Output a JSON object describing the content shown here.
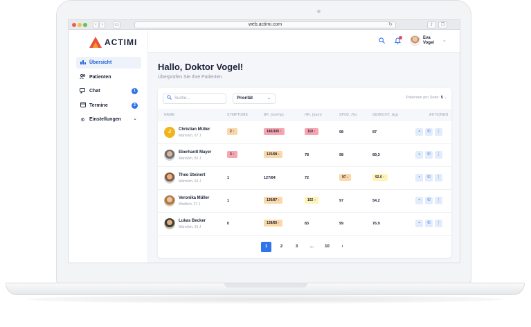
{
  "browser": {
    "url": "web.actimi.com",
    "back": "‹",
    "forward": "›",
    "reload": "↻"
  },
  "brand": {
    "logo_text": "ACTIMI",
    "accent": "#e8503a",
    "logo_orange": "#f29b2b"
  },
  "sidebar": {
    "items": [
      {
        "label": "Übersicht",
        "icon": "chart-bar-icon",
        "glyph": "▮",
        "active": true
      },
      {
        "label": "Patienten",
        "icon": "users-icon",
        "glyph": "👥"
      },
      {
        "label": "Chat",
        "icon": "chat-icon",
        "glyph": "💬",
        "badge": "1"
      },
      {
        "label": "Termine",
        "icon": "calendar-icon",
        "glyph": "▦",
        "badge": "2"
      },
      {
        "label": "Einstellungen",
        "icon": "gear-icon",
        "glyph": "⚙",
        "chevron": "⌄"
      }
    ]
  },
  "topbar": {
    "user_first": "Eva",
    "user_last": "Vogel"
  },
  "main": {
    "greeting": "Hallo, Doktor Vogel!",
    "subtitle": "Überprüfen Sie Ihre Patienten"
  },
  "filters": {
    "search_placeholder": "Suche...",
    "priority_label": "Priorität",
    "per_page_label": "Patienten pro Seite:",
    "per_page_value": "5"
  },
  "table": {
    "headers": [
      "NAME",
      "SYMPTOME",
      "BP, (mmHg)",
      "HR, (bpm)",
      "SPO2, (%)",
      "GEWICHT, (kg)",
      "AKTIONEN"
    ],
    "rows": [
      {
        "name": "Christian Müller",
        "meta": "Männlich, 67 J",
        "initial": "J",
        "symptoms": "2 ↑",
        "symptoms_level": "orange",
        "bp": "140/100 ↑",
        "bp_level": "red",
        "hr": "110 ↑",
        "hr_level": "red",
        "spo2": "98",
        "spo2_level": "",
        "weight": "87",
        "weight_level": ""
      },
      {
        "name": "Eberhardt Mayer",
        "meta": "Männlich, 82 J",
        "initial": "",
        "symptoms": "3 ↑",
        "symptoms_level": "red",
        "bp": "125/98 ↓",
        "bp_level": "orange",
        "hr": "78",
        "hr_level": "",
        "spo2": "98",
        "spo2_level": "",
        "weight": "89,3",
        "weight_level": ""
      },
      {
        "name": "Theo Steinert",
        "meta": "Männlich, 54 J",
        "initial": "",
        "symptoms": "1",
        "symptoms_level": "",
        "bp": "127/84",
        "bp_level": "",
        "hr": "72",
        "hr_level": "",
        "spo2": "97 ↓",
        "spo2_level": "orange",
        "weight": "92.6 ↑",
        "weight_level": "yellow"
      },
      {
        "name": "Veronika Müller",
        "meta": "Weiblich, 27 J",
        "initial": "",
        "symptoms": "1",
        "symptoms_level": "",
        "bp": "136/87 ↑",
        "bp_level": "orange",
        "hr": "102 ↑",
        "hr_level": "yellow",
        "spo2": "97",
        "spo2_level": "",
        "weight": "54.2",
        "weight_level": ""
      },
      {
        "name": "Lukas Becker",
        "meta": "Männlich, 31 J",
        "initial": "",
        "symptoms": "0",
        "symptoms_level": "",
        "bp": "138/85 ↑",
        "bp_level": "orange",
        "hr": "83",
        "hr_level": "",
        "spo2": "99",
        "spo2_level": "",
        "weight": "76.9",
        "weight_level": ""
      }
    ],
    "actions": [
      "message-icon",
      "phone-icon",
      "more-icon"
    ]
  },
  "pagination": {
    "pages": [
      "1",
      "2",
      "3",
      "...",
      "10"
    ],
    "next": "›",
    "current": "1"
  },
  "colors": {
    "primary": "#2f74ea",
    "danger": "#f7a5b0",
    "warning": "#fbd8a9",
    "caution": "#fff3b8"
  }
}
